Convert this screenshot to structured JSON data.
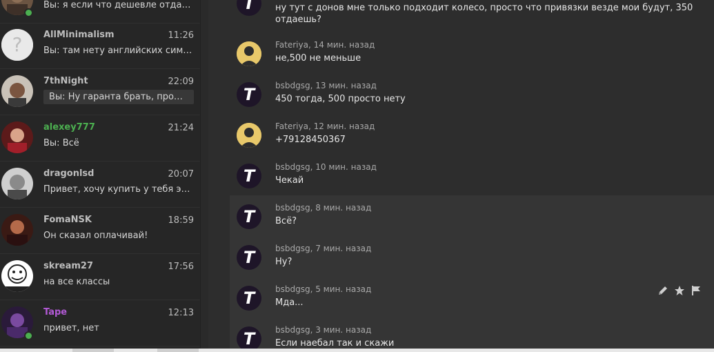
{
  "dialogs": [
    {
      "name": "",
      "time": "",
      "preview": "Вы: я если что дешевле отдать м...",
      "name_color": "#bdbdbd",
      "online": true
    },
    {
      "name": "AllMinimalism",
      "time": "11:26",
      "preview": "Вы: там нету английских символ...",
      "name_color": "#bdbdbd",
      "online": false
    },
    {
      "name": "7thNight",
      "time": "22:09",
      "preview": "Вы: Ну гаранта брать, продае...",
      "name_color": "#bdbdbd",
      "online": false
    },
    {
      "name": "alexey777",
      "time": "21:24",
      "preview": "Вы: Всё",
      "name_color": "#4caf50",
      "online": false
    },
    {
      "name": "dragonlsd",
      "time": "20:07",
      "preview": "Привет, хочу купить у тебя этот ...",
      "name_color": "#bdbdbd",
      "online": false
    },
    {
      "name": "FomaNSK",
      "time": "18:59",
      "preview": "Он сказал оплачивай!",
      "name_color": "#bdbdbd",
      "online": false
    },
    {
      "name": "skream27",
      "time": "17:56",
      "preview": "на все классы",
      "name_color": "#bdbdbd",
      "online": false
    },
    {
      "name": "Tape",
      "time": "12:13",
      "preview": "привет, нет",
      "name_color": "#b35ad6",
      "online": true
    }
  ],
  "messages": [
    {
      "author": "",
      "when": "",
      "text": "ну тут с донов мне только подходит колесо, просто что привязки везде мои будут, 350",
      "text2": "отдаешь?"
    },
    {
      "author": "Fateriya",
      "when": "14 мин. назад",
      "text": "не,500 не меньше"
    },
    {
      "author": "bsbdgsg",
      "when": "13 мин. назад",
      "text": "450 тогда, 500 просто нету"
    },
    {
      "author": "Fateriya",
      "when": "12 мин. назад",
      "text": "+79128450367"
    },
    {
      "author": "bsbdgsg",
      "when": "10 мин. назад",
      "text": "Чекай"
    },
    {
      "author": "bsbdgsg",
      "when": "8 мин. назад",
      "text": "Всё?"
    },
    {
      "author": "bsbdgsg",
      "when": "7 мин. назад",
      "text": "Ну?"
    },
    {
      "author": "bsbdgsg",
      "when": "5 мин. назад",
      "text": "Мда..."
    },
    {
      "author": "bsbdgsg",
      "when": "3 мин. назад",
      "text": "Если наебал так и скажи"
    }
  ],
  "action_icons": [
    "pencil-icon",
    "star-icon",
    "flag-icon"
  ],
  "colors": {
    "accent_green": "#4caf50",
    "accent_purple": "#b35ad6",
    "avatar_t_bg": "#1e1528",
    "avatar_yellow": "#e8c86a"
  }
}
